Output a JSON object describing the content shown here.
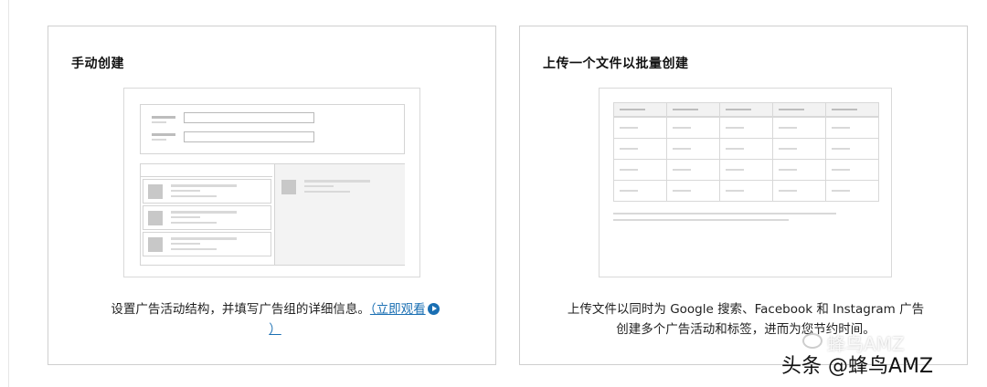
{
  "manual_card": {
    "title": "手动创建",
    "description": "设置广告活动结构，并填写广告组的详细信息。",
    "watch_link": "（立即观看",
    "watch_close": "）"
  },
  "upload_card": {
    "title": "上传一个文件以批量创建",
    "description_line1": "上传文件以同时为 Google 搜索、Facebook 和 Instagram 广告",
    "description_line2": "创建多个广告活动和标签，进而为您节约时间。"
  },
  "watermark": {
    "bottom": "头条 @蜂鸟AMZ",
    "faint": "蜂鸟AMZ"
  },
  "colors": {
    "link": "#1a6fb3",
    "border": "#cfcfcf"
  }
}
